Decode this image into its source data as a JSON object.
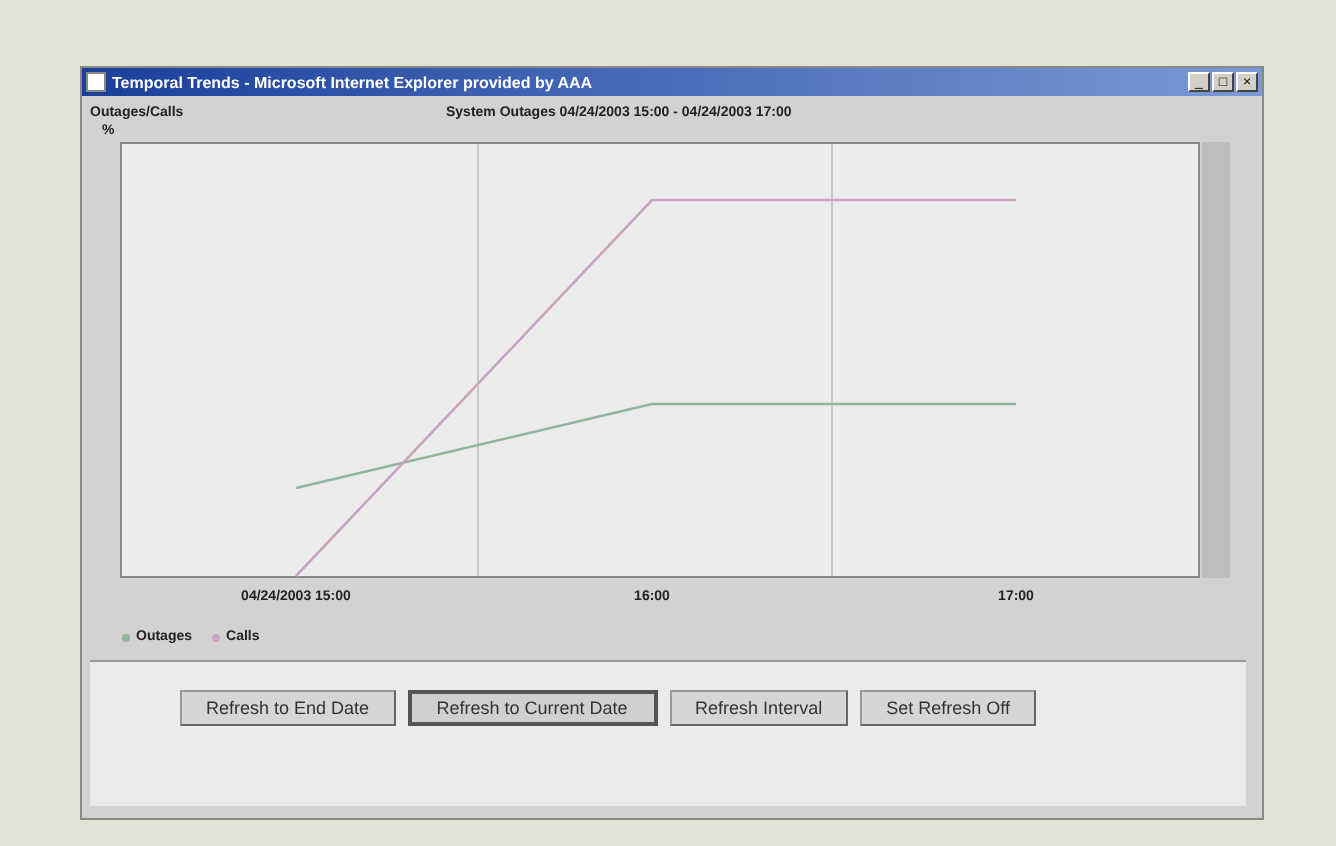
{
  "window": {
    "title": "Temporal Trends - Microsoft Internet Explorer provided by AAA",
    "controls": [
      "_",
      "□",
      "×"
    ]
  },
  "header": {
    "left_label": "Outages/Calls",
    "center_label": "System Outages  04/24/2003 15:00 - 04/24/2003 17:00"
  },
  "chart": {
    "y_label": "%",
    "categories": [
      "04/24/2003 15:00",
      "16:00",
      "17:00"
    ],
    "legend": [
      {
        "name": "Outages",
        "color": "#8fb59a"
      },
      {
        "name": "Calls",
        "color": "#c9a3c0"
      }
    ]
  },
  "buttons": [
    {
      "label": "Refresh to End Date",
      "selected": false
    },
    {
      "label": "Refresh to Current Date",
      "selected": true
    },
    {
      "label": "Refresh Interval",
      "selected": false
    },
    {
      "label": "Set Refresh Off",
      "selected": false
    }
  ]
}
